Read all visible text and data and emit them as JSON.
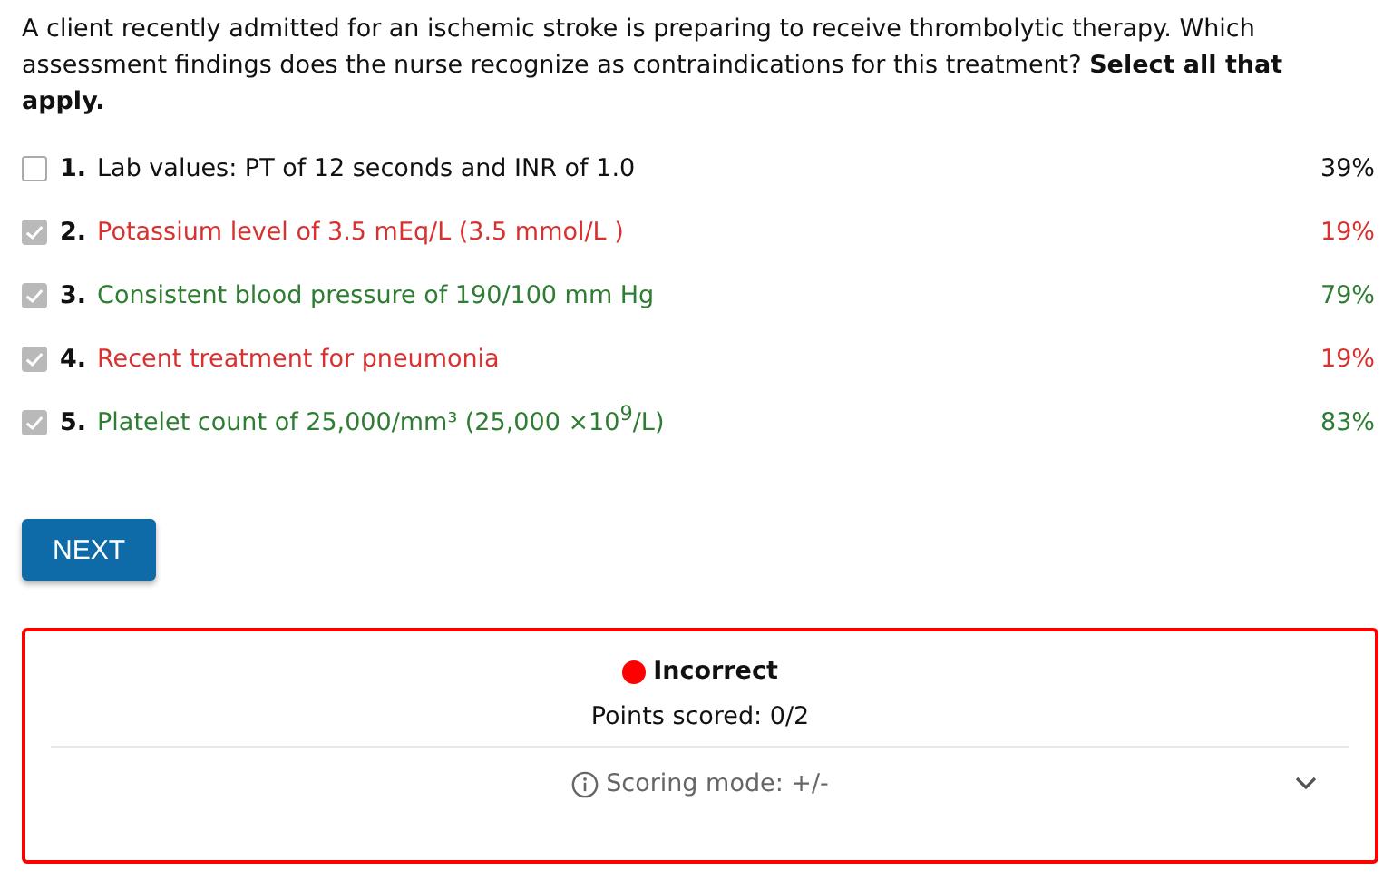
{
  "question": "A client recently admitted for an ischemic stroke is preparing to receive thrombolytic therapy. Which assessment findings does the nurse recognize as contraindications for this treatment? **Select all that apply.**",
  "options": [
    {
      "number": "1.",
      "text": "Lab values: PT of 12 seconds and INR of 1.0",
      "percent": "39%",
      "checked": false,
      "color": "#111111"
    },
    {
      "number": "2.",
      "text": "Potassium level of 3.5 mEq/L (3.5 mmol/L )",
      "percent": "19%",
      "checked": true,
      "color": "#d9312f"
    },
    {
      "number": "3.",
      "text": "Consistent blood pressure of 190/100 mm Hg",
      "percent": "79%",
      "checked": true,
      "color": "#2e7d32"
    },
    {
      "number": "4.",
      "text": "Recent treatment for pneumonia",
      "percent": "19%",
      "checked": true,
      "color": "#d9312f"
    },
    {
      "number": "5.",
      "text": "Platelet count of 25,000/mm³ (25,000 ×10$^{9}$/L)",
      "percent": "83%",
      "checked": true,
      "color": "#2e7d32"
    }
  ],
  "next_button": "NEXT",
  "feedback": {
    "status": "Incorrect",
    "color": "#ff0000",
    "points": "Points scored: 0/2",
    "scoring_mode": "Scoring mode: +/-",
    "expanded": false
  }
}
